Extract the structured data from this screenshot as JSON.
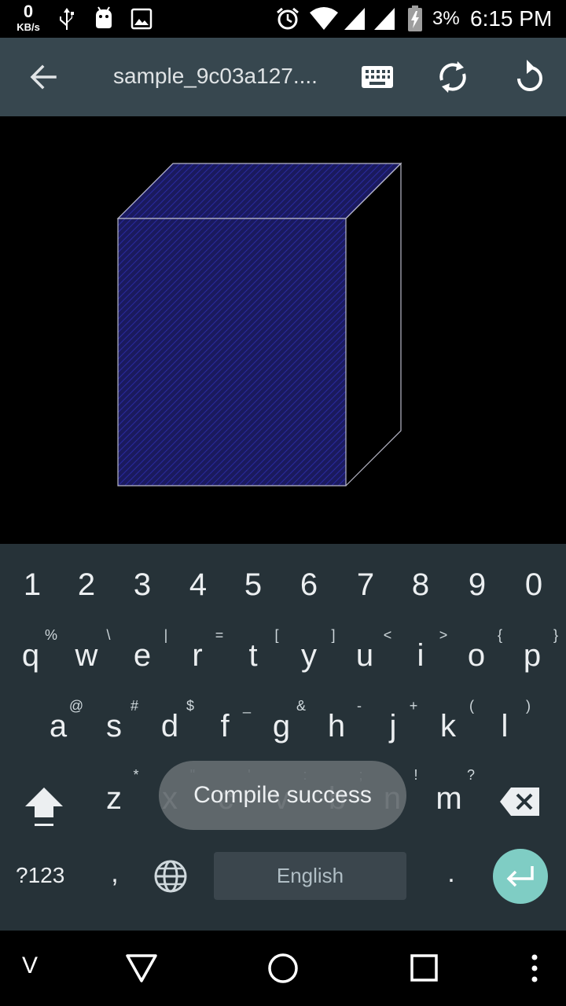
{
  "status_bar": {
    "net_speed_value": "0",
    "net_speed_unit": "KB/s",
    "battery_percent": "3%",
    "time": "6:15 PM",
    "icons": [
      "usb-icon",
      "android-icon",
      "image-icon",
      "alarm-icon",
      "wifi-icon",
      "signal-icon",
      "signal-icon",
      "battery-charging-icon"
    ]
  },
  "app_bar": {
    "title": "sample_9c03a127....",
    "icons": [
      "back-arrow-icon",
      "keyboard-icon",
      "sync-icon",
      "reset-icon"
    ]
  },
  "viewport": {
    "shape": "cube",
    "face_color": "#1a1a5e",
    "hatch_color": "#2a2aa0",
    "edge_color": "#b8b8c8"
  },
  "keyboard": {
    "numbers": [
      "1",
      "2",
      "3",
      "4",
      "5",
      "6",
      "7",
      "8",
      "9",
      "0"
    ],
    "row1": [
      "q",
      "w",
      "e",
      "r",
      "t",
      "y",
      "u",
      "i",
      "o",
      "p"
    ],
    "row1_hints": [
      "%",
      "\\",
      "|",
      "=",
      "[",
      "]",
      "<",
      ">",
      "{",
      "}"
    ],
    "row2": [
      "a",
      "s",
      "d",
      "f",
      "g",
      "h",
      "j",
      "k",
      "l"
    ],
    "row2_hints": [
      "@",
      "#",
      "$",
      "_",
      "&",
      "-",
      "+",
      "(",
      ")"
    ],
    "row3": [
      "z",
      "x",
      "c",
      "v",
      "b",
      "n",
      "m"
    ],
    "row3_hints": [
      "*",
      "\"",
      "'",
      ":",
      ";",
      "!",
      "?"
    ],
    "symbols_label": "?123",
    "comma": ",",
    "space_label": "English",
    "period": ".",
    "accent_color": "#7fcdc4"
  },
  "toast": {
    "message": "Compile success"
  },
  "nav_bar": {
    "v_label": "V",
    "icons": [
      "back-triangle-icon",
      "home-circle-icon",
      "recents-square-icon",
      "more-vert-icon"
    ]
  }
}
